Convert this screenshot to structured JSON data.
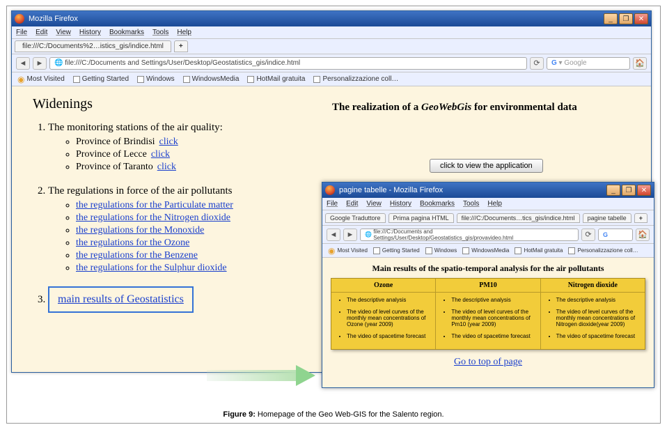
{
  "win1": {
    "title": "Mozilla Firefox",
    "menu": [
      "File",
      "Edit",
      "View",
      "History",
      "Bookmarks",
      "Tools",
      "Help"
    ],
    "tab": "file:///C:/Documents%2…istics_gis/indice.html",
    "url": "file:///C:/Documents and Settings/User/Desktop/Geostatistics_gis/indice.html",
    "search_placeholder": "Google",
    "bookmarks": [
      "Most Visited",
      "Getting Started",
      "Windows",
      "WindowsMedia",
      "HotMail gratuita",
      "Personalizzazione coll…"
    ]
  },
  "page1": {
    "heading": "Widenings",
    "right_title_a": "The realization of a ",
    "right_title_em": "GeoWebGis",
    "right_title_b": " for environmental data",
    "item1": "The monitoring stations of the air quality:",
    "prov1": "Province of Brindisi",
    "prov2": "Province of Lecce",
    "prov3": "Province of Taranto",
    "click": "click",
    "appbtn": "click to view the application",
    "item2": "The regulations in force of the air pollutants",
    "regs": [
      "the regulations for the Particulate matter",
      "the regulations for the Nitrogen dioxide",
      "the regulations for the Monoxide",
      "the regulations for the Ozone",
      "the regulations for the Benzene",
      "the regulations for the Sulphur dioxide"
    ],
    "item3": "main results of Geostatistics"
  },
  "win2": {
    "title": "pagine tabelle - Mozilla Firefox",
    "menu": [
      "File",
      "Edit",
      "View",
      "History",
      "Bookmarks",
      "Tools",
      "Help"
    ],
    "tabs": [
      "Google Traduttore",
      "Prima pagina HTML",
      "file:///C:/Documents…tics_gis/indice.html",
      "pagine tabelle"
    ],
    "url": "file:///C:/Documents and Settings/User/Desktop/Geostatistics_gis/provavideo.html",
    "bookmarks": [
      "Most Visited",
      "Getting Started",
      "Windows",
      "WindowsMedia",
      "HotMail gratuita",
      "Personalizzazione coll…"
    ]
  },
  "page2": {
    "heading": "Main results of the spatio-temporal analysis for the air pollutants",
    "cols": [
      {
        "h": "Ozone",
        "items": [
          "The descriptive analysis",
          "The video of level curves of the monthly mean concentrations of Ozone (year 2009)",
          "The video of spacetime forecast"
        ]
      },
      {
        "h": "PM10",
        "items": [
          "The descriptive analysis",
          "The video of level curves of the monthly mean concentrations of Pm10 (year 2009)",
          "The video of spacetime forecast"
        ]
      },
      {
        "h": "Nitrogen dioxide",
        "items": [
          "The descriptive analysis",
          "The video of level curves of the monthly mean concentrations of Nitrogen dioxide(year 2009)",
          "The video of spacetime forecast"
        ]
      }
    ],
    "gotop": "Go to top of page"
  },
  "caption_b": "Figure 9:",
  "caption_t": " Homepage of the Geo Web-GIS for the Salento region."
}
